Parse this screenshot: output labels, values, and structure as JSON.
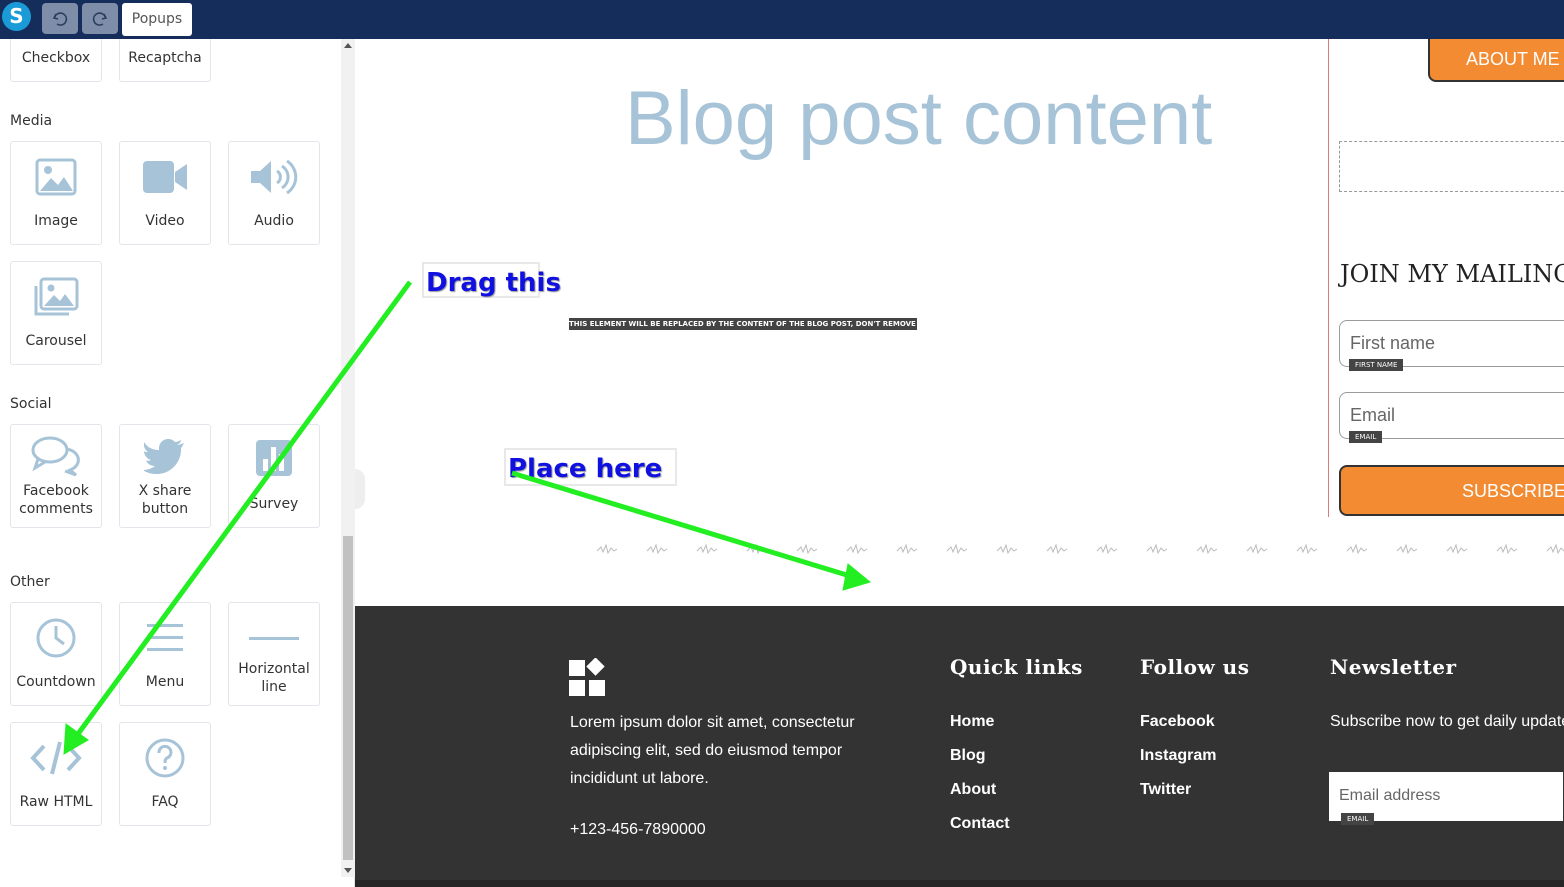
{
  "topbar": {
    "logo_letter": "S",
    "undo_icon": "undo-icon",
    "redo_icon": "redo-icon",
    "popups_label": "Popups",
    "bg_color": "#152d5a"
  },
  "sidebar": {
    "top_items": [
      {
        "label": "Checkbox"
      },
      {
        "label": "Recaptcha"
      }
    ],
    "sections": [
      {
        "title": "Media",
        "items": [
          {
            "label": "Image",
            "icon": "image-icon"
          },
          {
            "label": "Video",
            "icon": "video-icon"
          },
          {
            "label": "Audio",
            "icon": "audio-icon"
          },
          {
            "label": "Carousel",
            "icon": "carousel-icon"
          }
        ]
      },
      {
        "title": "Social",
        "items": [
          {
            "label": "Facebook comments",
            "icon": "comments-icon"
          },
          {
            "label": "X share button",
            "icon": "twitter-icon"
          },
          {
            "label": "Survey",
            "icon": "survey-icon"
          }
        ]
      },
      {
        "title": "Other",
        "items": [
          {
            "label": "Countdown",
            "icon": "clock-icon"
          },
          {
            "label": "Menu",
            "icon": "menu-icon"
          },
          {
            "label": "Horizontal line",
            "icon": "horizontal-line-icon"
          },
          {
            "label": "Raw HTML",
            "icon": "code-icon"
          },
          {
            "label": "FAQ",
            "icon": "question-icon"
          }
        ]
      }
    ],
    "icon_color": "#a7c3d7"
  },
  "canvas": {
    "blog_title": "Blog post content",
    "replace_note": "THIS ELEMENT WILL BE REPLACED BY THE CONTENT OF THE BLOG POST, DON'T REMOVE IT",
    "about_button": "ABOUT ME",
    "mailing_title": "JOIN MY MAILING LIST",
    "first_name_placeholder": "First name",
    "first_name_tag": "FIRST NAME",
    "email_placeholder": "Email",
    "email_tag": "EMAIL",
    "subscribe_button": "SUBSCRIBE",
    "accent_color": "#f38b32"
  },
  "footer": {
    "about_text": "Lorem ipsum dolor sit amet, consectetur adipiscing elit, sed do eiusmod tempor incididunt ut labore.",
    "phone": "+123-456-7890000",
    "quick_links": {
      "title": "Quick links",
      "links": [
        "Home",
        "Blog",
        "About",
        "Contact"
      ]
    },
    "follow_us": {
      "title": "Follow us",
      "links": [
        "Facebook",
        "Instagram",
        "Twitter"
      ]
    },
    "newsletter": {
      "title": "Newsletter",
      "text": "Subscribe now to get daily updates",
      "email_placeholder": "Email address",
      "email_tag": "EMAIL"
    },
    "bg_color": "#333333"
  },
  "annotations": {
    "drag_this": "Drag this",
    "place_here": "Place here",
    "arrow_color": "#22ee22"
  }
}
